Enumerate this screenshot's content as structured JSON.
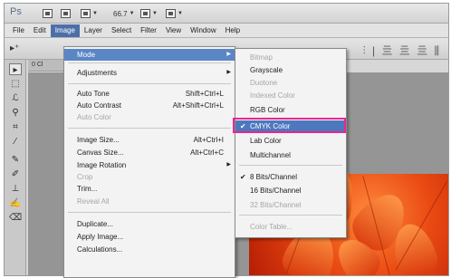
{
  "app": {
    "logo": "Ps"
  },
  "app_bar": {
    "zoom": "66.7",
    "icons": [
      "bridge-icon",
      "mini-bridge-icon",
      "view-extras-icon",
      "zoom-level",
      "arrange-documents-icon",
      "screen-mode-icon"
    ]
  },
  "menubar": {
    "items": [
      "File",
      "Edit",
      "Image",
      "Layer",
      "Select",
      "Filter",
      "View",
      "Window",
      "Help"
    ],
    "active": "Image"
  },
  "options_bar": {
    "tool_glyph": "▸⁺",
    "align_glyphs": "⫶ | 亖 亖 亖 ⫼"
  },
  "document": {
    "tab_label": "0 Cl"
  },
  "image_menu": {
    "items": [
      {
        "label": "Mode",
        "shortcut": "",
        "submenu": true,
        "state": "highlighted"
      },
      {
        "label": "Adjustments",
        "shortcut": "",
        "submenu": true,
        "state": "normal"
      },
      {
        "label": "Auto Tone",
        "shortcut": "Shift+Ctrl+L",
        "state": "normal"
      },
      {
        "label": "Auto Contrast",
        "shortcut": "Alt+Shift+Ctrl+L",
        "state": "normal"
      },
      {
        "label": "Auto Color",
        "shortcut": "",
        "state": "disabled"
      },
      {
        "label": "Image Size...",
        "shortcut": "Alt+Ctrl+I",
        "state": "normal"
      },
      {
        "label": "Canvas Size...",
        "shortcut": "Alt+Ctrl+C",
        "state": "normal"
      },
      {
        "label": "Image Rotation",
        "shortcut": "",
        "submenu": true,
        "state": "normal"
      },
      {
        "label": "Crop",
        "shortcut": "",
        "state": "disabled"
      },
      {
        "label": "Trim...",
        "shortcut": "",
        "state": "normal"
      },
      {
        "label": "Reveal All",
        "shortcut": "",
        "state": "disabled"
      },
      {
        "label": "Duplicate...",
        "shortcut": "",
        "state": "normal"
      },
      {
        "label": "Apply Image...",
        "shortcut": "",
        "state": "normal"
      },
      {
        "label": "Calculations...",
        "shortcut": "",
        "state": "normal"
      }
    ]
  },
  "mode_menu": {
    "items": [
      {
        "label": "Bitmap",
        "checked": false,
        "state": "disabled"
      },
      {
        "label": "Grayscale",
        "checked": false,
        "state": "normal"
      },
      {
        "label": "Duotone",
        "checked": false,
        "state": "disabled"
      },
      {
        "label": "Indexed Color",
        "checked": false,
        "state": "disabled"
      },
      {
        "label": "RGB Color",
        "checked": false,
        "state": "normal"
      },
      {
        "label": "CMYK Color",
        "checked": true,
        "state": "highlighted"
      },
      {
        "label": "Lab Color",
        "checked": false,
        "state": "normal"
      },
      {
        "label": "Multichannel",
        "checked": false,
        "state": "normal"
      },
      {
        "label": "8 Bits/Channel",
        "checked": true,
        "state": "normal"
      },
      {
        "label": "16 Bits/Channel",
        "checked": false,
        "state": "normal"
      },
      {
        "label": "32 Bits/Channel",
        "checked": false,
        "state": "disabled"
      },
      {
        "label": "Color Table...",
        "checked": false,
        "state": "disabled"
      }
    ],
    "check_glyph": "✔"
  },
  "colors": {
    "highlight": "#5a86c6",
    "callout_border": "#e8278f",
    "disabled_text": "#a6a6a6",
    "photo_orange": "#ea4a12"
  }
}
